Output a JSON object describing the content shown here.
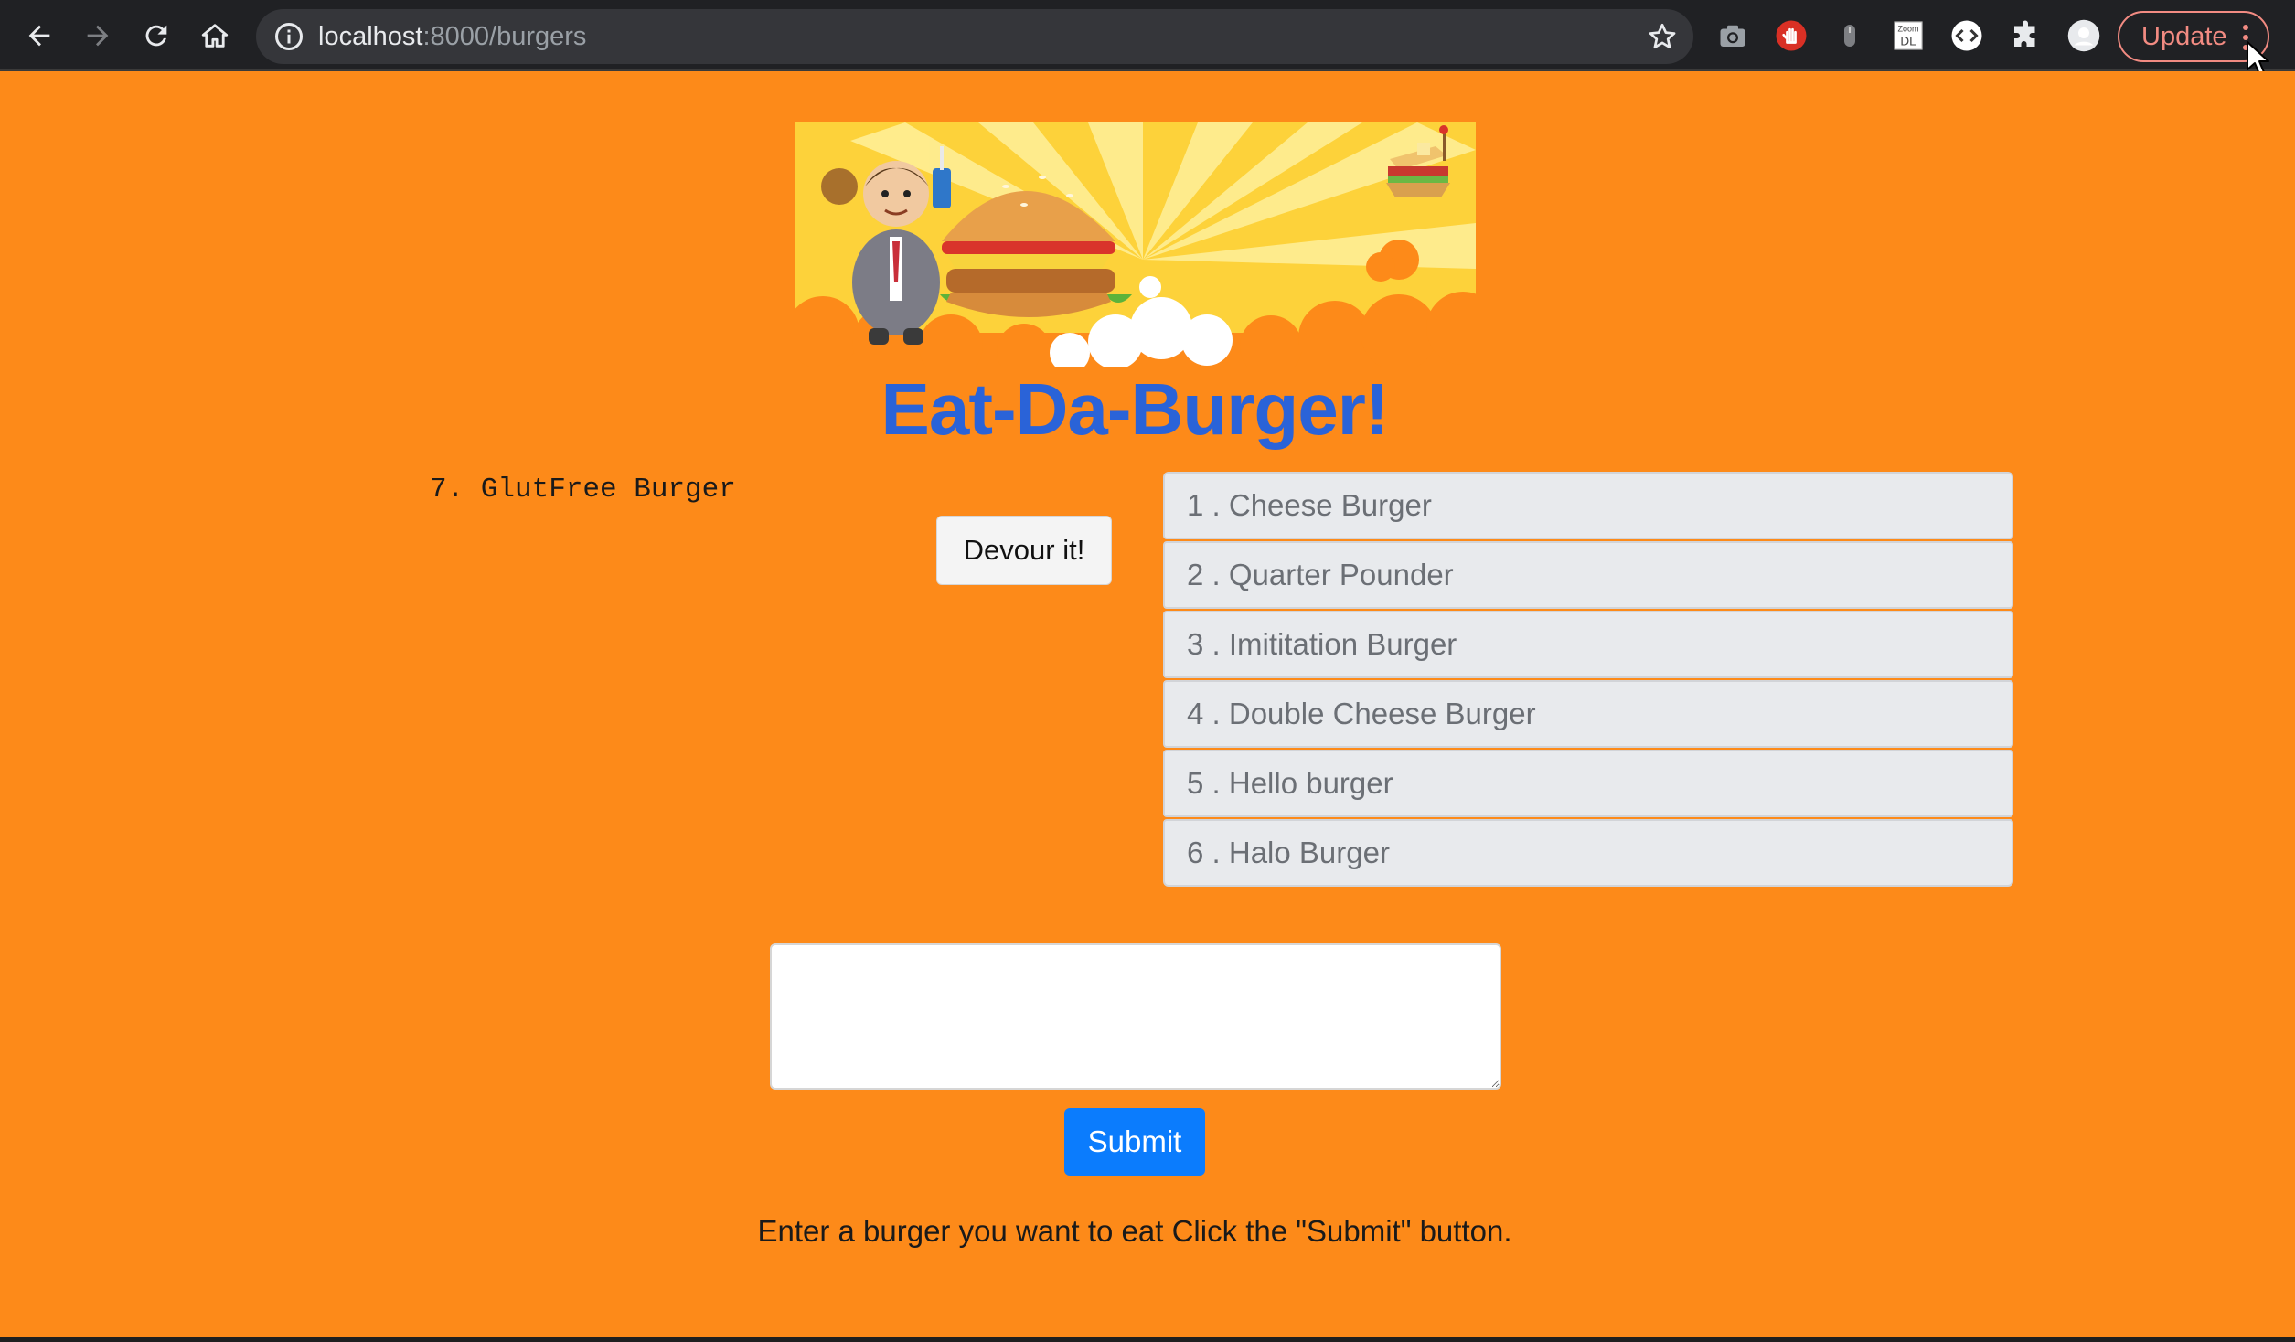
{
  "browser": {
    "url_host": "localhost",
    "url_path": ":8000/burgers",
    "update_label": "Update",
    "icons": [
      "back-arrow-icon",
      "forward-arrow-icon",
      "reload-icon",
      "home-icon",
      "info-icon",
      "bookmark-star-icon",
      "camera-extension-icon",
      "hand-stop-extension-icon",
      "mouse-extension-icon",
      "zoom-dl-extension-icon",
      "code-extension-icon",
      "puzzle-extensions-icon",
      "profile-avatar-icon",
      "kebab-menu-icon"
    ],
    "zoom_ext_label_top": "Zoom",
    "zoom_ext_label_bottom": "DL"
  },
  "page": {
    "title": "Eat-Da-Burger!",
    "devoured_item": "7. GlutFree Burger",
    "devour_button_label": "Devour it!",
    "burgers": [
      "1 . Cheese Burger",
      "2 . Quarter Pounder",
      "3 . Imititation Burger",
      "4 . Double Cheese Burger",
      "5 . Hello burger",
      "6 . Halo Burger"
    ],
    "input_value": "",
    "submit_label": "Submit",
    "instructions": "Enter a burger you want to eat Click the \"Submit\" button."
  },
  "colors": {
    "page_background": "#fd8a19",
    "title": "#2a63d8",
    "submit": "#0b7cfd",
    "list_item_bg": "#e8eaed"
  }
}
